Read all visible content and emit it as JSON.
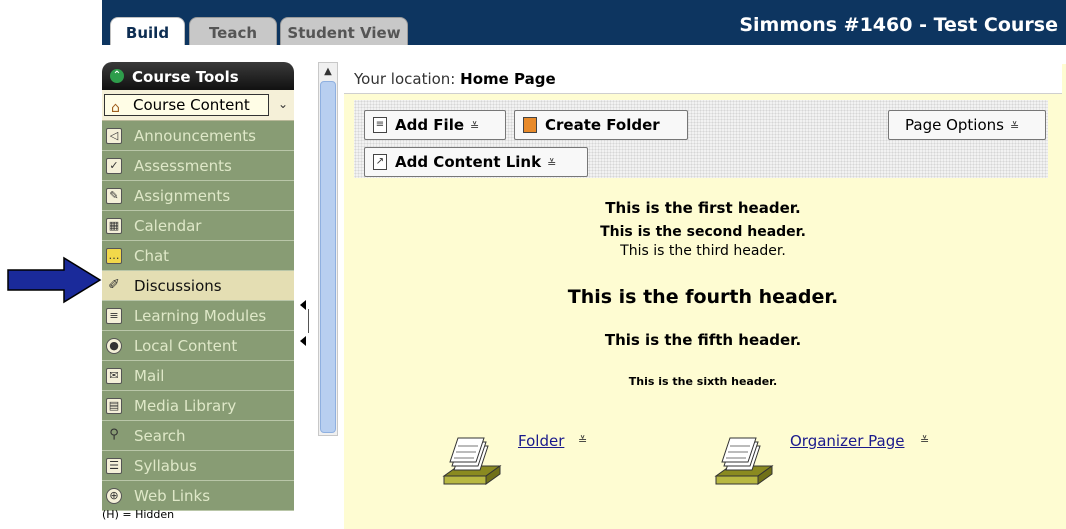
{
  "tabs": [
    {
      "label": "Build",
      "active": true
    },
    {
      "label": "Teach",
      "active": false
    },
    {
      "label": "Student View",
      "active": false
    }
  ],
  "course_title": "Simmons #1460 - Test Course",
  "sidebar": {
    "header": "Course Tools",
    "selector": "Course Content",
    "items": [
      {
        "label": "Announcements",
        "icon": "megaphone-icon"
      },
      {
        "label": "Assessments",
        "icon": "assessment-icon"
      },
      {
        "label": "Assignments",
        "icon": "pencil-paper-icon"
      },
      {
        "label": "Calendar",
        "icon": "calendar-icon"
      },
      {
        "label": "Chat",
        "icon": "chat-bubble-icon"
      },
      {
        "label": "Discussions",
        "icon": "pushpin-icon"
      },
      {
        "label": "Learning Modules",
        "icon": "document-icon"
      },
      {
        "label": "Local Content",
        "icon": "disc-icon"
      },
      {
        "label": "Mail",
        "icon": "envelope-icon"
      },
      {
        "label": "Media Library",
        "icon": "media-icon"
      },
      {
        "label": "Search",
        "icon": "magnifier-icon"
      },
      {
        "label": "Syllabus",
        "icon": "syllabus-icon"
      },
      {
        "label": "Web Links",
        "icon": "globe-icon"
      }
    ],
    "hidden_note": "(H) = Hidden"
  },
  "location": {
    "prefix": "Your location:",
    "page": "Home Page"
  },
  "toolbar": {
    "add_file": "Add File",
    "create_folder": "Create Folder",
    "page_options": "Page Options",
    "add_content_link": "Add Content Link"
  },
  "content": {
    "header1": "This is the first header.",
    "header2": "This is the second header.",
    "header3": "This is the third header.",
    "header4": "This is the fourth header.",
    "header5": "This is the fifth header.",
    "header6": "This is the sixth header."
  },
  "items": [
    {
      "label": "Folder"
    },
    {
      "label": "Organizer Page"
    }
  ],
  "colors": {
    "topbar": "#0d3560",
    "sidebar_item": "#889c74",
    "sidebar_selected": "#e4deb3",
    "content_bg": "#fefcd2",
    "arrow": "#1a2a9a"
  }
}
